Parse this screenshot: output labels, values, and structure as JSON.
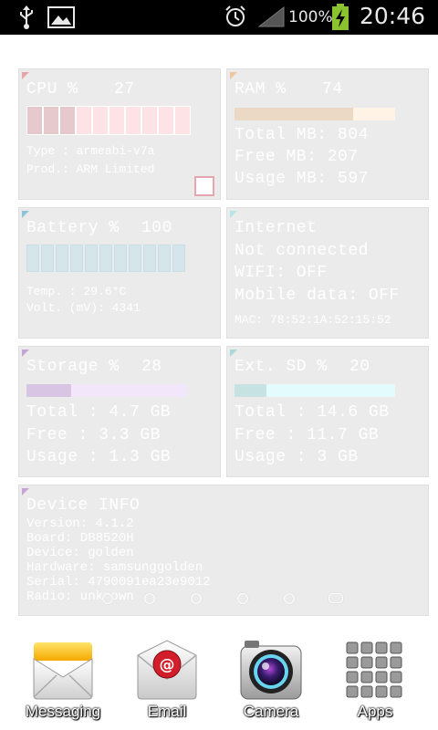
{
  "status_bar": {
    "battery_percent": "100%",
    "time": "20:46",
    "icons": [
      "usb-icon",
      "gallery-icon",
      "alarm-icon",
      "signal-icon",
      "battery-charging-icon"
    ]
  },
  "cpu": {
    "title": "CPU %",
    "value": "27",
    "type": "Type : armeabi-v7a",
    "prod": "Prod.: ARM Limited",
    "level": 0.27,
    "color": "#e6a5ad"
  },
  "ram": {
    "title": "RAM %",
    "value": "74",
    "total": "Total MB: 804",
    "free": "Free MB: 207",
    "usage": "Usage MB: 597",
    "level": 0.74,
    "color": "#f1c59d"
  },
  "battery": {
    "title": "Battery %",
    "value": "100",
    "temp": "Temp. : 29.6*C",
    "volt": "Volt. (mV): 4341",
    "level": 1.0,
    "color": "#8fc4d9"
  },
  "internet": {
    "title": "Internet",
    "status": "Not connected",
    "wifi": "WIFI: OFF",
    "mobile": "Mobile data: OFF",
    "mac": "MAC: 78:52:1A:52:15:52",
    "color": "#b6e4ea"
  },
  "storage": {
    "title": "Storage %",
    "value": "28",
    "total": "Total : 4.7 GB",
    "free": "Free : 3.3 GB",
    "usage": "Usage : 1.3 GB",
    "level": 0.28,
    "color": "#c3a6d6"
  },
  "ext_sd": {
    "title": "Ext. SD %",
    "value": "20",
    "total": "Total : 14.6 GB",
    "free": "Free : 11.7 GB",
    "usage": "Usage : 3 GB",
    "level": 0.2,
    "color": "#a9d9da"
  },
  "device": {
    "title": "Device INFO",
    "version": "Version: 4.1.2",
    "board": "Board: DB8520H",
    "device": "Device: golden",
    "hardware": "Hardware: samsunggolden",
    "serial": "Serial: 4790091ea23e9012",
    "radio": "Radio: unknown",
    "color": "#c9a3d8"
  },
  "page_indicator": {
    "pages": 6,
    "active": 6
  },
  "dock": [
    {
      "label": "Messaging",
      "icon": "messaging-icon"
    },
    {
      "label": "Email",
      "icon": "email-icon"
    },
    {
      "label": "Camera",
      "icon": "camera-icon"
    },
    {
      "label": "Apps",
      "icon": "apps-grid-icon"
    }
  ]
}
